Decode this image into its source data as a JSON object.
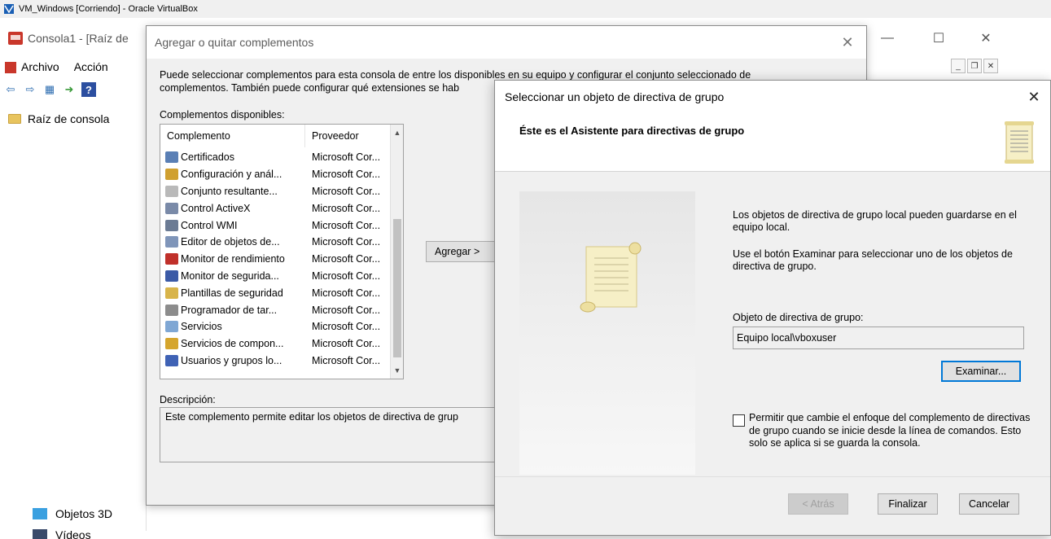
{
  "vbox": {
    "title": "VM_Windows [Corriendo] - Oracle VirtualBox"
  },
  "mmc": {
    "title": "Consola1 - [Raíz de",
    "menu": {
      "file": "Archivo",
      "action": "Acción"
    },
    "tree_root": "Raíz de consola",
    "explorer_items": [
      "Objetos 3D",
      "Vídeos"
    ]
  },
  "snapins": {
    "title": "Agregar o quitar complementos",
    "description_line1": "Puede seleccionar complementos para esta consola de entre los disponibles en su equipo y configurar el conjunto seleccionado de",
    "description_line2": "complementos. También puede configurar qué extensiones se hab",
    "available_label": "Complementos disponibles:",
    "columns": [
      "Complemento",
      "Proveedor"
    ],
    "rows": [
      {
        "name": "Certificados",
        "vendor": "Microsoft Cor...",
        "icon": "certificate-icon",
        "color": "#5a7fb5"
      },
      {
        "name": "Configuración y anál...",
        "vendor": "Microsoft Cor...",
        "icon": "security-config-icon",
        "color": "#d0a030"
      },
      {
        "name": "Conjunto resultante...",
        "vendor": "Microsoft Cor...",
        "icon": "policy-document-icon",
        "color": "#b9b9b9"
      },
      {
        "name": "Control ActiveX",
        "vendor": "Microsoft Cor...",
        "icon": "activex-icon",
        "color": "#7a8aa8"
      },
      {
        "name": "Control WMI",
        "vendor": "Microsoft Cor...",
        "icon": "wmi-icon",
        "color": "#6b7b94"
      },
      {
        "name": "Editor de objetos de...",
        "vendor": "Microsoft Cor...",
        "icon": "gpo-editor-icon",
        "color": "#7f95b9"
      },
      {
        "name": "Monitor de rendimiento",
        "vendor": "Microsoft Cor...",
        "icon": "performance-monitor-icon",
        "color": "#c0302a"
      },
      {
        "name": "Monitor de segurida...",
        "vendor": "Microsoft Cor...",
        "icon": "security-monitor-icon",
        "color": "#3b5aa6"
      },
      {
        "name": "Plantillas de seguridad",
        "vendor": "Microsoft Cor...",
        "icon": "security-templates-icon",
        "color": "#d8b44a"
      },
      {
        "name": "Programador de tar...",
        "vendor": "Microsoft Cor...",
        "icon": "task-scheduler-icon",
        "color": "#8c8c8c"
      },
      {
        "name": "Servicios",
        "vendor": "Microsoft Cor...",
        "icon": "services-icon",
        "color": "#7fa7d4"
      },
      {
        "name": "Servicios de compon...",
        "vendor": "Microsoft Cor...",
        "icon": "component-services-icon",
        "color": "#d5a52d"
      },
      {
        "name": "Usuarios y grupos lo...",
        "vendor": "Microsoft Cor...",
        "icon": "users-groups-icon",
        "color": "#3f62b5"
      }
    ],
    "add_button": "Agregar >",
    "desc_label": "Descripción:",
    "desc_text": "Este complemento permite editar los objetos de directiva de grup"
  },
  "gpo": {
    "title": "Seleccionar un objeto de directiva de grupo",
    "heading": "Éste es el Asistente para directivas de grupo",
    "text1": "Los objetos de directiva de grupo local pueden guardarse en el equipo local.",
    "text2": "Use el botón Examinar para seleccionar uno de los objetos de directiva de grupo.",
    "object_label": "Objeto de directiva de grupo:",
    "object_value": "Equipo local\\vboxuser",
    "browse_button": "Examinar...",
    "checkbox_label": "Permitir que cambie el enfoque del complemento de directivas de grupo cuando se inicie desde la línea de comandos. Esto solo se aplica si se guarda la consola.",
    "checkbox_checked": false,
    "back_button": "< Atrás",
    "finish_button": "Finalizar",
    "cancel_button": "Cancelar"
  }
}
